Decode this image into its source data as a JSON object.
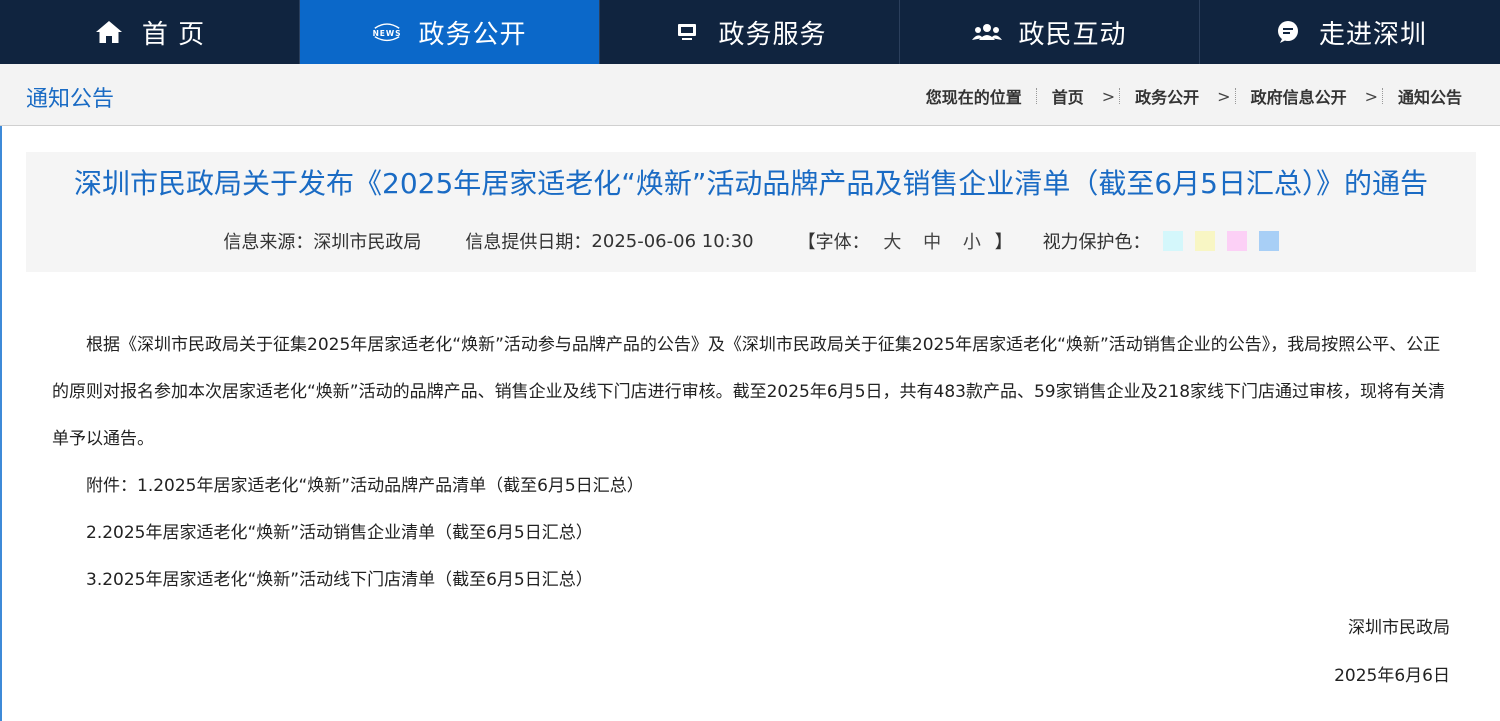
{
  "nav": [
    {
      "label": "首 页",
      "icon": "home-icon"
    },
    {
      "label": "政务公开",
      "icon": "news-icon",
      "icon_text": "NEWS",
      "active": true
    },
    {
      "label": "政务服务",
      "icon": "monitor-icon"
    },
    {
      "label": "政民互动",
      "icon": "people-icon"
    },
    {
      "label": "走进深圳",
      "icon": "chat-bubble-icon"
    }
  ],
  "breadcrumb": {
    "section_title": "通知公告",
    "location_label": "您现在的位置",
    "items": [
      "首页",
      "政务公开",
      "政府信息公开",
      "通知公告"
    ],
    "separator": ">"
  },
  "article": {
    "title": "深圳市民政局关于发布《2025年居家适老化“焕新”活动品牌产品及销售企业清单（截至6月5日汇总）》的通告",
    "source_label": "信息来源：",
    "source": "深圳市民政局",
    "date_label": "信息提供日期：",
    "date": "2025-06-06 10:30",
    "font_label": "【字体：",
    "font_sizes": [
      "大",
      "中",
      "小"
    ],
    "font_close": "】",
    "eye_color_label": "视力保护色：",
    "eye_colors": [
      "#d4f7fb",
      "#f8f6c4",
      "#fcd0f6",
      "#a8cff6"
    ],
    "body": "根据《深圳市民政局关于征集2025年居家适老化“焕新”活动参与品牌产品的公告》及《深圳市民政局关于征集2025年居家适老化“焕新”活动销售企业的公告》，我局按照公平、公正的原则对报名参加本次居家适老化“焕新”活动的品牌产品、销售企业及线下门店进行审核。截至2025年6月5日，共有483款产品、59家销售企业及218家线下门店通过审核，现将有关清单予以通告。",
    "attachments": [
      "附件：1.2025年居家适老化“焕新”活动品牌产品清单（截至6月5日汇总）",
      "2.2025年居家适老化“焕新”活动销售企业清单（截至6月5日汇总）",
      "3.2025年居家适老化“焕新”活动线下门店清单（截至6月5日汇总）"
    ],
    "signature": "深圳市民政局",
    "sign_date": "2025年6月6日"
  }
}
